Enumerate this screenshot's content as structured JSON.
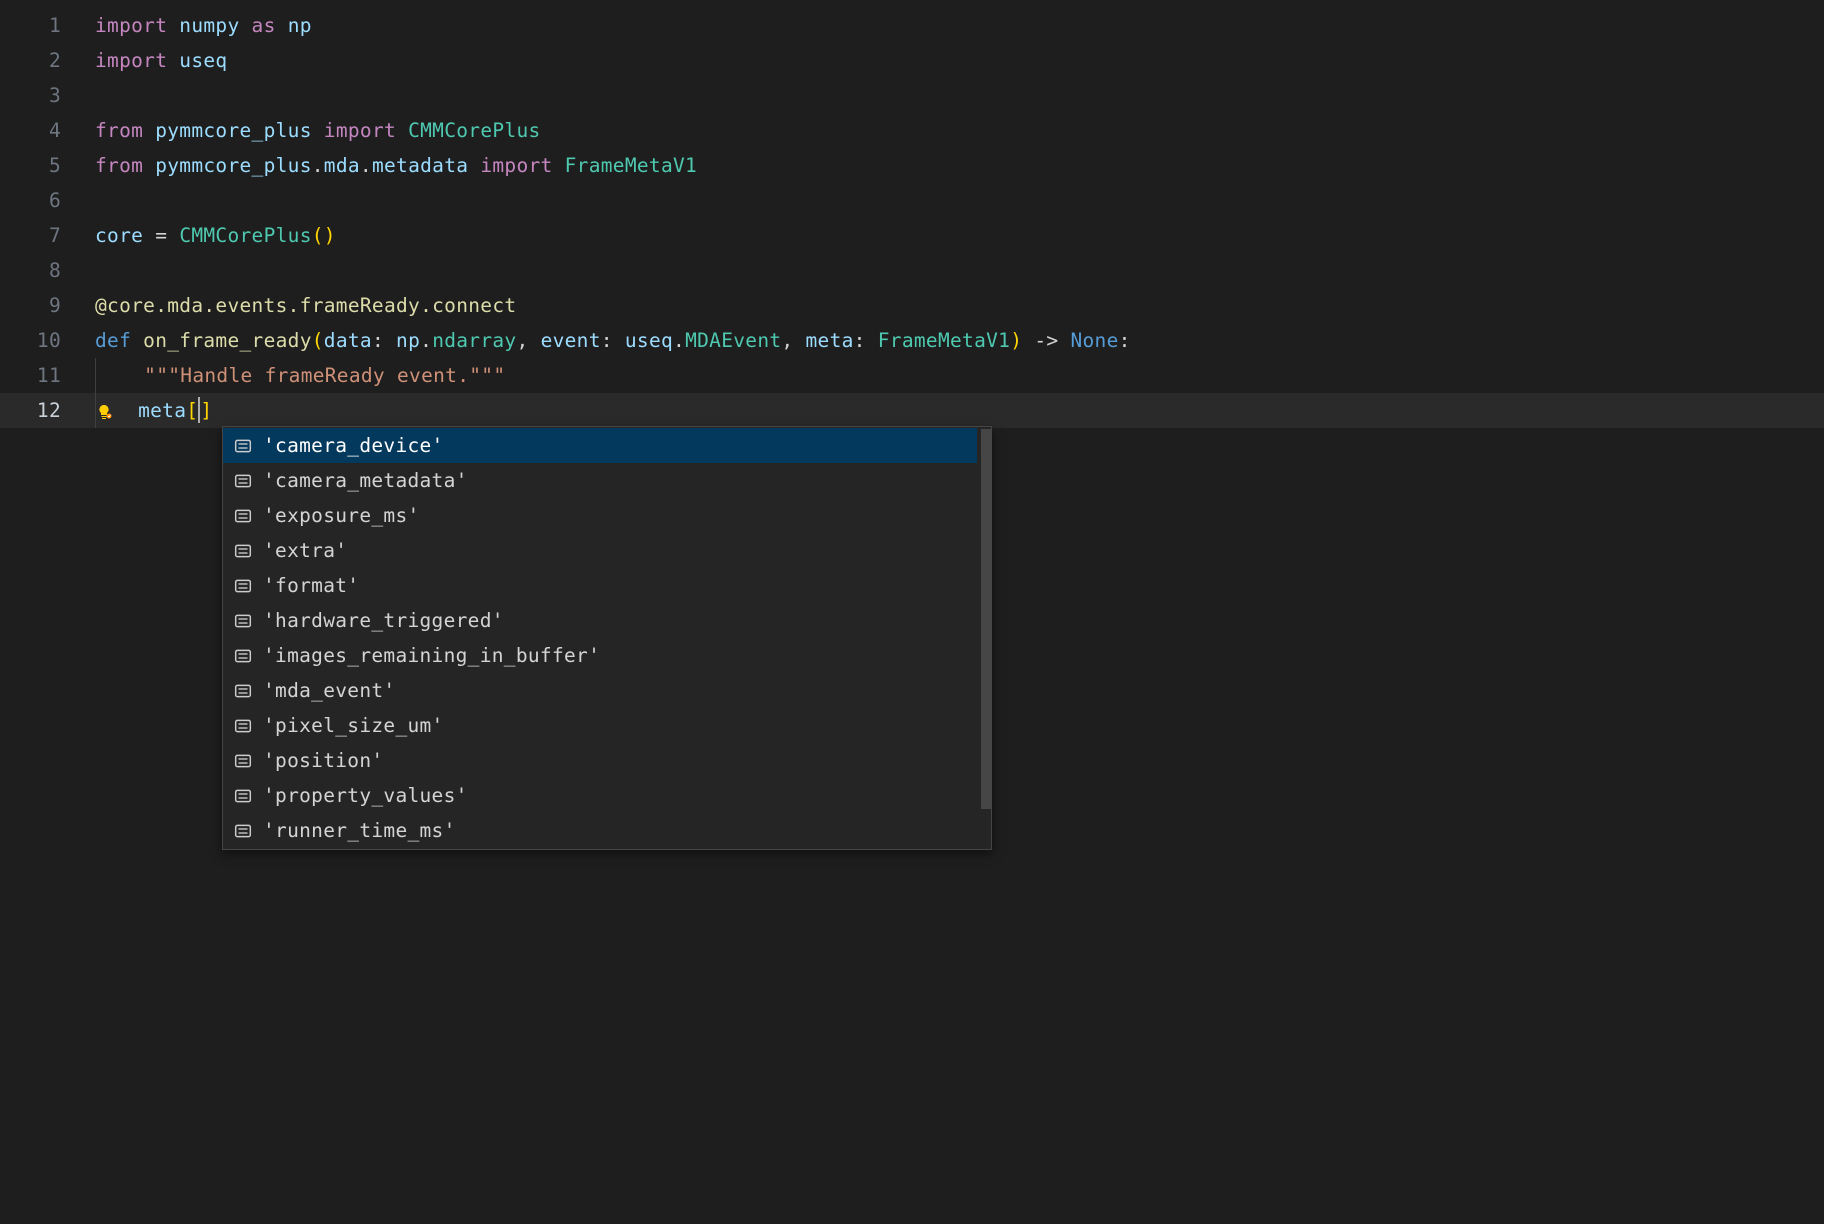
{
  "lines": [
    {
      "n": "1"
    },
    {
      "n": "2"
    },
    {
      "n": "3"
    },
    {
      "n": "4"
    },
    {
      "n": "5"
    },
    {
      "n": "6"
    },
    {
      "n": "7"
    },
    {
      "n": "8"
    },
    {
      "n": "9"
    },
    {
      "n": "10"
    },
    {
      "n": "11"
    },
    {
      "n": "12"
    }
  ],
  "tokens": {
    "import": "import",
    "from": "from",
    "as": "as",
    "def": "def",
    "numpy": "numpy",
    "np": "np",
    "useq": "useq",
    "pymmcore_plus": "pymmcore_plus",
    "mda": "mda",
    "metadata": "metadata",
    "CMMCorePlus": "CMMCorePlus",
    "FrameMetaV1": "FrameMetaV1",
    "core": "core",
    "decorator": "@core.mda.events.frameReady.connect",
    "on_frame_ready": "on_frame_ready",
    "data": "data",
    "event": "event",
    "meta": "meta",
    "ndarray": "ndarray",
    "MDAEvent": "MDAEvent",
    "None": "None",
    "docstring": "\"\"\"Handle frameReady event.\"\"\"",
    "lbracket": "[",
    "rbracket": "]"
  },
  "autocomplete": {
    "items": [
      {
        "label": "'camera_device'",
        "selected": true
      },
      {
        "label": "'camera_metadata'",
        "selected": false
      },
      {
        "label": "'exposure_ms'",
        "selected": false
      },
      {
        "label": "'extra'",
        "selected": false
      },
      {
        "label": "'format'",
        "selected": false
      },
      {
        "label": "'hardware_triggered'",
        "selected": false
      },
      {
        "label": "'images_remaining_in_buffer'",
        "selected": false
      },
      {
        "label": "'mda_event'",
        "selected": false
      },
      {
        "label": "'pixel_size_um'",
        "selected": false
      },
      {
        "label": "'position'",
        "selected": false
      },
      {
        "label": "'property_values'",
        "selected": false
      },
      {
        "label": "'runner_time_ms'",
        "selected": false
      }
    ]
  }
}
